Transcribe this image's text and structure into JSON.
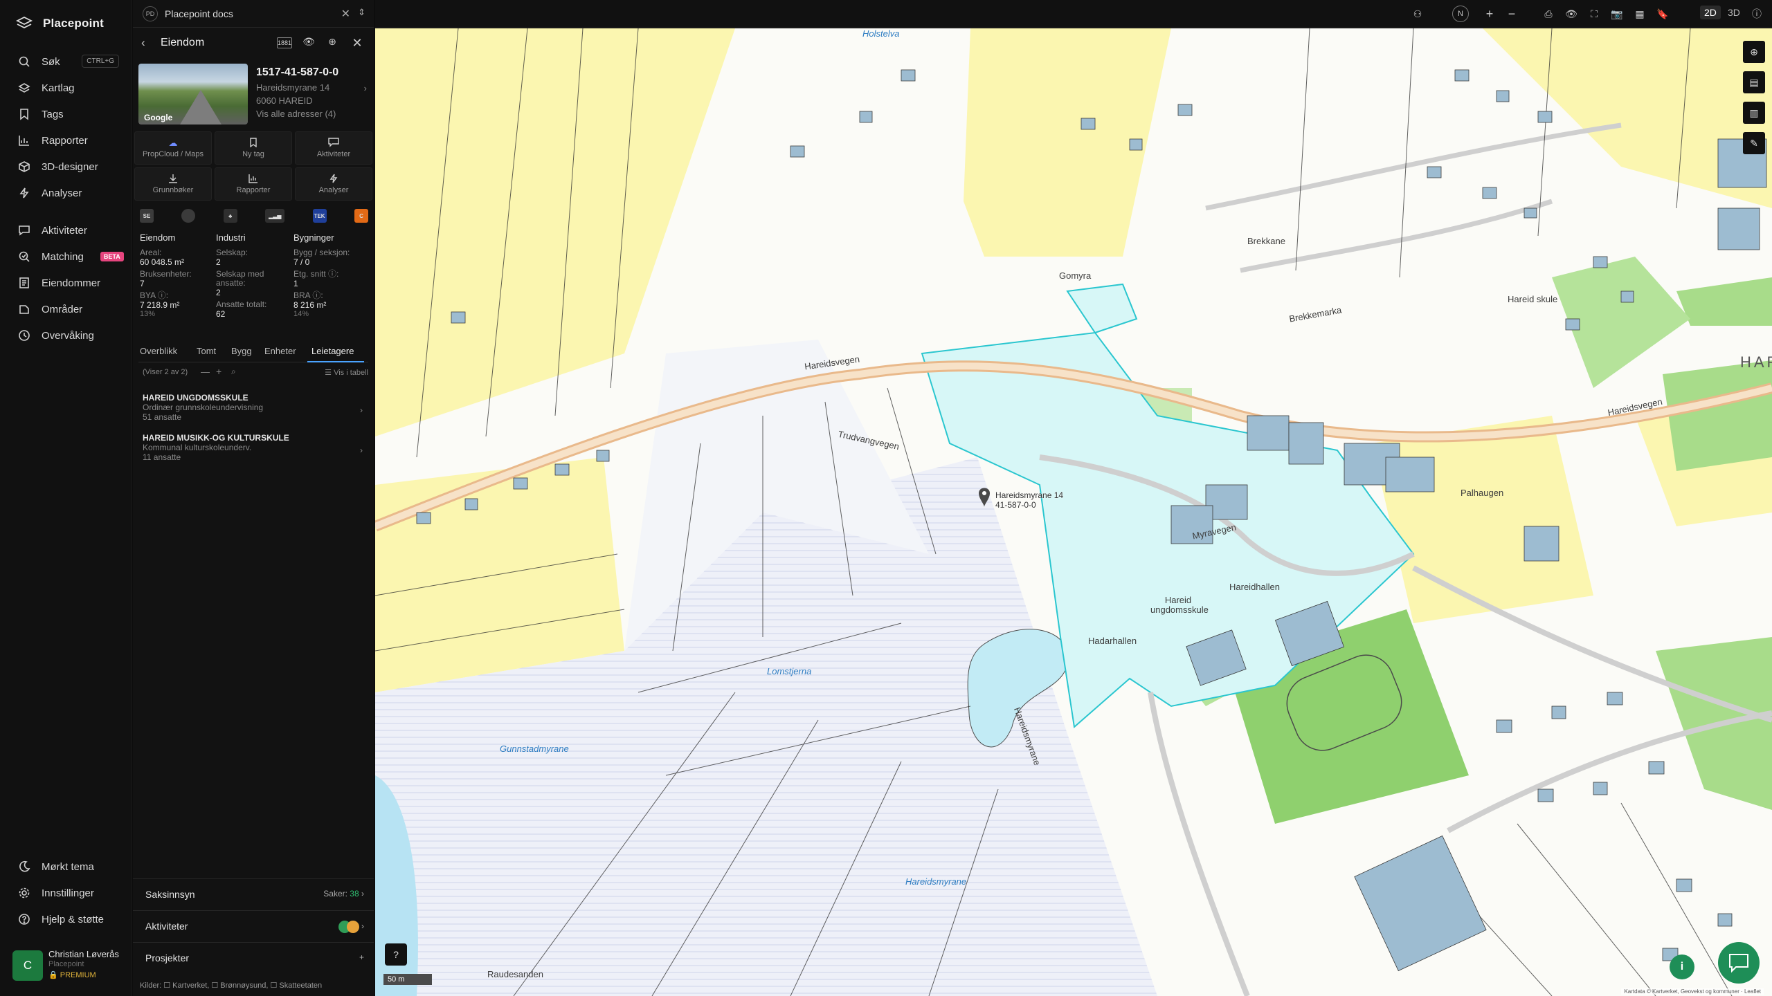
{
  "app": {
    "name": "Placepoint"
  },
  "nav": {
    "items": [
      {
        "label": "Søk",
        "icon": "search-icon",
        "shortcut": "CTRL+G"
      },
      {
        "label": "Kartlag",
        "icon": "layers-icon"
      },
      {
        "label": "Tags",
        "icon": "bookmark-icon"
      },
      {
        "label": "Rapporter",
        "icon": "chart-icon"
      },
      {
        "label": "3D-designer",
        "icon": "cube-icon"
      },
      {
        "label": "Analyser",
        "icon": "bolt-icon"
      },
      {
        "label": "Aktiviteter",
        "icon": "chat-icon"
      },
      {
        "label": "Matching",
        "icon": "match-icon",
        "badge": "BETA"
      },
      {
        "label": "Eiendommer",
        "icon": "list-icon"
      },
      {
        "label": "Områder",
        "icon": "area-icon"
      },
      {
        "label": "Overvåking",
        "icon": "monitor-icon"
      }
    ],
    "bottom": [
      {
        "label": "Mørkt tema",
        "icon": "moon-icon"
      },
      {
        "label": "Innstillinger",
        "icon": "gear-icon"
      },
      {
        "label": "Hjelp & støtte",
        "icon": "help-icon"
      }
    ],
    "user": {
      "initial": "C",
      "name": "Christian Løverås",
      "org": "Placepoint",
      "plan": "PREMIUM"
    }
  },
  "panel": {
    "doc_badge": "PD",
    "doc_title": "Placepoint docs",
    "title": "Eiendom",
    "property": {
      "id": "1517-41-587-0-0",
      "address": "Hareidsmyrane 14",
      "postal": "6060 HAREID",
      "all_addresses": "Vis alle adresser (4)",
      "photo_credit": "Google"
    },
    "actions": [
      "PropCloud / Maps",
      "Ny tag",
      "Aktiviteter",
      "Grunnbøker",
      "Rapporter",
      "Analyser"
    ],
    "sources": [
      "SE",
      "",
      "",
      "",
      "TEK",
      "C"
    ],
    "stats": {
      "eiendom": {
        "heading": "Eiendom",
        "areal_label": "Areal:",
        "areal": "60 048.5 m²",
        "bruks_label": "Bruksenheter:",
        "bruks": "7",
        "bya_label": "BYA ⓘ:",
        "bya": "7 218.9 m²",
        "bya_pct": "13%"
      },
      "industri": {
        "heading": "Industri",
        "selskap_label": "Selskap:",
        "selskap": "2",
        "ansatte_label": "Selskap med ansatte:",
        "ansatte": "2",
        "total_label": "Ansatte totalt:",
        "total": "62"
      },
      "bygninger": {
        "heading": "Bygninger",
        "bygg_label": "Bygg / seksjon:",
        "bygg": "7 / 0",
        "etg_label": "Etg. snitt ⓘ:",
        "etg": "1",
        "bra_label": "BRA ⓘ:",
        "bra": "8 216 m²",
        "bra_pct": "14%"
      }
    },
    "tabs": [
      "Overblikk",
      "Tomt",
      "Bygg",
      "Enheter",
      "Leietagere"
    ],
    "list_count": "(Viser 2 av 2)",
    "list_table": "Vis i tabell",
    "lessees": [
      {
        "name": "HAREID UNGDOMSSKULE",
        "desc": "Ordinær grunnskoleundervisning",
        "emp": "51 ansatte"
      },
      {
        "name": "HAREID MUSIKK-OG KULTURSKULE",
        "desc": "Kommunal kulturskoleunderv.",
        "emp": "11 ansatte"
      }
    ],
    "sections": {
      "saksinnsyn": "Saksinnsyn",
      "saker_label": "Saker:",
      "saker": "38",
      "aktiviteter": "Aktiviteter",
      "prosjekter": "Prosjekter"
    },
    "sources_footer": "Kilder: ☐ Kartverket, ☐ Brønnøysund, ☐ Skatteetaten"
  },
  "topbar": {
    "north": "N",
    "mode_2d": "2D",
    "mode_3d": "3D"
  },
  "map": {
    "labels": {
      "hareidsvegen_a": "Hareidsvegen",
      "hareidsvegen_b": "Hareidsvegen",
      "trudvangvegen": "Trudvangvegen",
      "myravegen": "Myravegen",
      "hareidsmyrane": "Hareidsmyrane",
      "hareidsmyrane_road": "Hareidsmyrane",
      "lomstjerna": "Lomstjerna",
      "gunnstadmyrane": "Gunnstadmyrane",
      "gomyra": "Gomyra",
      "brekkane": "Brekkane",
      "brekkemarka": "Brekkemarka",
      "hareid_skule": "Hareid skule",
      "hareid_ungdomsskule": "Hareid ungdomsskule",
      "hareidhallen": "Hareidhallen",
      "hadarhallen": "Hadarhallen",
      "raudesanden": "Raudesanden",
      "paulhaugen": "Palhaugen",
      "holstelva": "Holstelva",
      "hareid_big": "HAR",
      "marker_addr": "Hareidsmyrane 14",
      "marker_id": "41-587-0-0"
    },
    "scale": "50 m",
    "attribution": "Kartdata © Kartverket, Geovekst og kommuner · Leaflet"
  }
}
